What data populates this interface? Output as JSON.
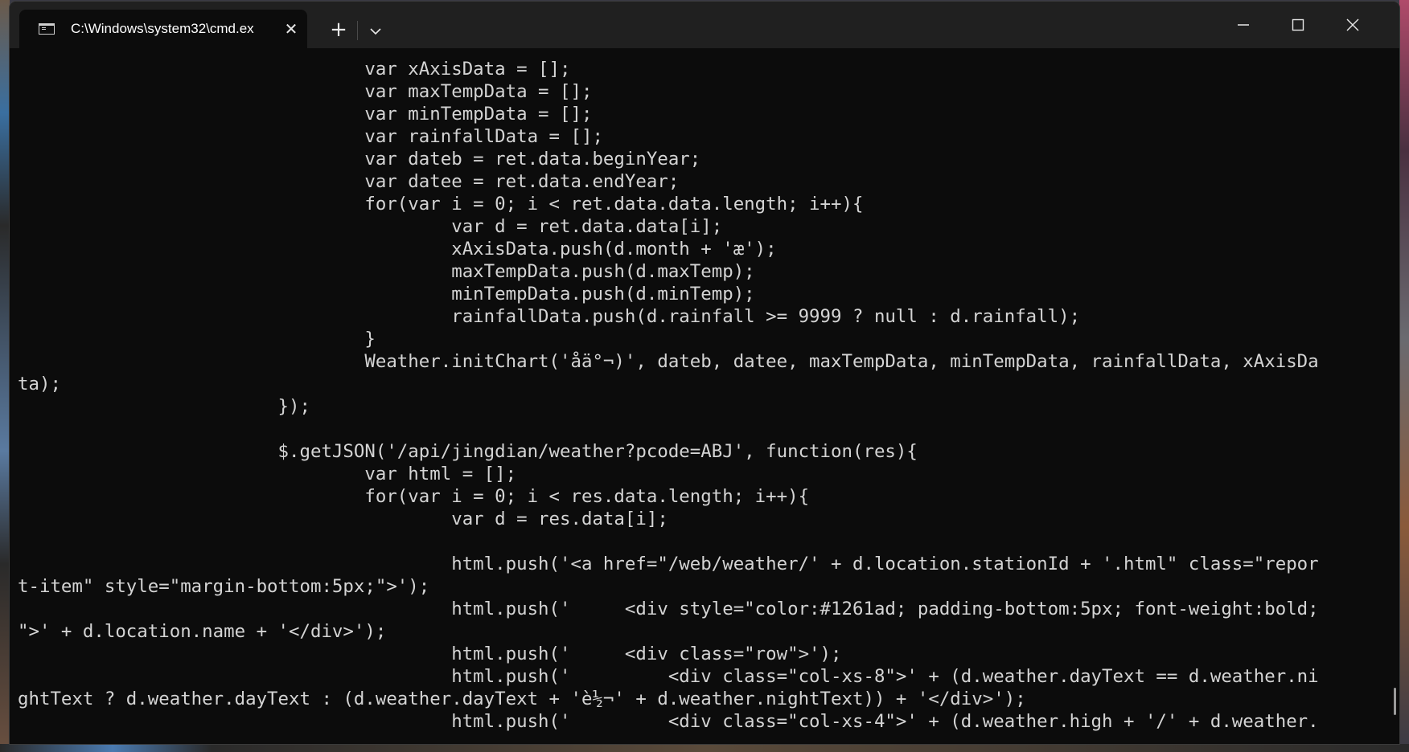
{
  "window": {
    "tab_title": "C:\\Windows\\system32\\cmd.ex",
    "close_tab_glyph": "✕",
    "new_tab_glyph": "+"
  },
  "icons": {
    "tab": "terminal-icon",
    "close": "close-icon",
    "new_tab": "plus-icon",
    "dropdown": "chevron-down-icon",
    "minimize": "minimize-icon",
    "maximize": "maximize-icon",
    "window_close": "window-close-icon"
  },
  "colors": {
    "console_bg": "#0c0c0c",
    "console_text": "#d4d4d4",
    "titlebar_bg": "#202020"
  },
  "console": {
    "lines": [
      "                                var xAxisData = [];",
      "                                var maxTempData = [];",
      "                                var minTempData = [];",
      "                                var rainfallData = [];",
      "                                var dateb = ret.data.beginYear;",
      "                                var datee = ret.data.endYear;",
      "                                for(var i = 0; i < ret.data.data.length; i++){",
      "                                        var d = ret.data.data[i];",
      "                                        xAxisData.push(d.month + 'æ');",
      "                                        maxTempData.push(d.maxTemp);",
      "                                        minTempData.push(d.minTemp);",
      "                                        rainfallData.push(d.rainfall >= 9999 ? null : d.rainfall);",
      "                                }",
      "                                Weather.initChart('åä°¬)', dateb, datee, maxTempData, minTempData, rainfallData, xAxisDa",
      "ta);",
      "                        });",
      "",
      "                        $.getJSON('/api/jingdian/weather?pcode=ABJ', function(res){",
      "                                var html = [];",
      "                                for(var i = 0; i < res.data.length; i++){",
      "                                        var d = res.data[i];",
      "",
      "                                        html.push('<a href=\"/web/weather/' + d.location.stationId + '.html\" class=\"repor",
      "t-item\" style=\"margin-bottom:5px;\">');",
      "                                        html.push('     <div style=\"color:#1261ad; padding-bottom:5px; font-weight:bold;",
      "\">' + d.location.name + '</div>');",
      "                                        html.push('     <div class=\"row\">');",
      "                                        html.push('         <div class=\"col-xs-8\">' + (d.weather.dayText == d.weather.ni",
      "ghtText ? d.weather.dayText : (d.weather.dayText + 'è½¬' + d.weather.nightText)) + '</div>');",
      "                                        html.push('         <div class=\"col-xs-4\">' + (d.weather.high + '/' + d.weather."
    ]
  }
}
